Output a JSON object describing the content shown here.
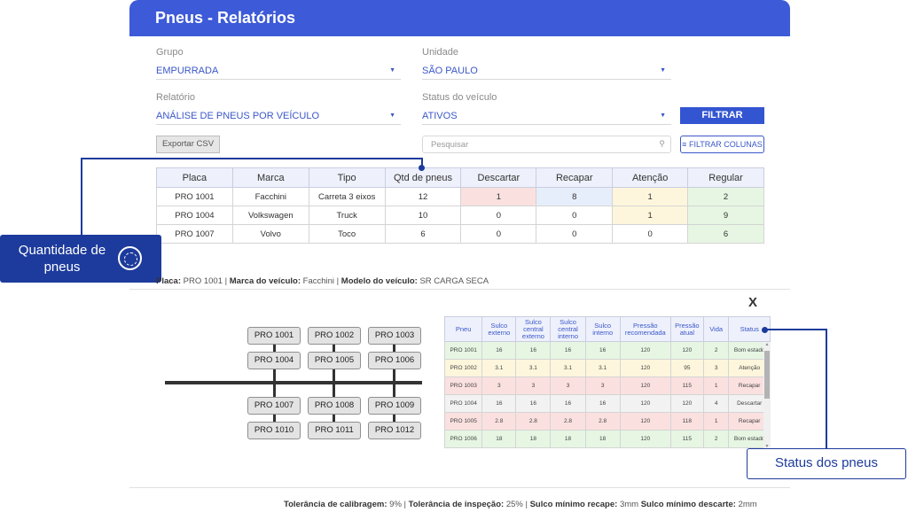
{
  "header": {
    "title": "Pneus - Relatórios"
  },
  "filters": {
    "grupo": {
      "label": "Grupo",
      "value": "EMPURRADA"
    },
    "unidade": {
      "label": "Unidade",
      "value": "SÃO PAULO"
    },
    "relatorio": {
      "label": "Relatório",
      "value": "ANÁLISE DE PNEUS POR VEÍCULO"
    },
    "status": {
      "label": "Status do veículo",
      "value": "ATIVOS"
    },
    "filtrar_label": "FILTRAR",
    "export_label": "Exportar CSV",
    "search_placeholder": "Pesquisar",
    "filter_columns_label": "FILTRAR COLUNAS"
  },
  "main_table": {
    "headers": [
      "Placa",
      "Marca",
      "Tipo",
      "Qtd de pneus",
      "Descartar",
      "Recapar",
      "Atenção",
      "Regular"
    ],
    "rows": [
      [
        "PRO 1001",
        "Facchini",
        "Carreta 3 eixos",
        "12",
        "1",
        "8",
        "1",
        "2"
      ],
      [
        "PRO 1004",
        "Volkswagen",
        "Truck",
        "10",
        "0",
        "0",
        "1",
        "9"
      ],
      [
        "PRO 1007",
        "Volvo",
        "Toco",
        "6",
        "0",
        "0",
        "0",
        "6"
      ]
    ]
  },
  "callouts": {
    "quantity": "Quantidade de pneus",
    "status": "Status dos pneus"
  },
  "vehicle_info": {
    "placa_label": "Placa:",
    "placa_value": "PRO 1001",
    "marca_label": "Marca do veículo:",
    "marca_value": "Facchini",
    "modelo_label": "Modelo do veículo:",
    "modelo_value": "SR CARGA SECA",
    "separator": "|"
  },
  "close_label": "X",
  "tire_slots": [
    "PRO 1001",
    "PRO 1002",
    "PRO 1003",
    "PRO 1004",
    "PRO 1005",
    "PRO 1006",
    "PRO 1007",
    "PRO 1008",
    "PRO 1009",
    "PRO 1010",
    "PRO 1011",
    "PRO 1012"
  ],
  "tire_table": {
    "headers": [
      "Pneu",
      "Sulco externo",
      "Sulco central externo",
      "Sulco central interno",
      "Sulco interno",
      "Pressão recomendada",
      "Pressão atual",
      "Vida",
      "Status"
    ],
    "rows": [
      {
        "cells": [
          "PRO 1001",
          "16",
          "16",
          "16",
          "16",
          "120",
          "120",
          "2",
          "Bom estado"
        ],
        "status": "green"
      },
      {
        "cells": [
          "PRO 1002",
          "3.1",
          "3.1",
          "3.1",
          "3.1",
          "120",
          "95",
          "3",
          "Atenção"
        ],
        "status": "yellow"
      },
      {
        "cells": [
          "PRO 1003",
          "3",
          "3",
          "3",
          "3",
          "120",
          "115",
          "1",
          "Recapar"
        ],
        "status": "red"
      },
      {
        "cells": [
          "PRO 1004",
          "16",
          "16",
          "16",
          "16",
          "120",
          "120",
          "4",
          "Descartar"
        ],
        "status": "gray"
      },
      {
        "cells": [
          "PRO 1005",
          "2.8",
          "2.8",
          "2.8",
          "2.8",
          "120",
          "118",
          "1",
          "Recapar"
        ],
        "status": "red"
      },
      {
        "cells": [
          "PRO 1006",
          "18",
          "18",
          "18",
          "18",
          "120",
          "115",
          "2",
          "Bom estado"
        ],
        "status": "green"
      }
    ]
  },
  "footer": {
    "calibragem_label": "Tolerância de calibragem:",
    "calibragem_value": "9%",
    "inspecao_label": "Tolerância de inspeção:",
    "inspecao_value": "25%",
    "recape_label": "Sulco mínimo recape:",
    "recape_value": "3mm",
    "descarte_label": "Sulco mínimo descarte:",
    "descarte_value": "2mm",
    "separator": "|"
  },
  "colors": {
    "header_blue": "#3d5ad8",
    "accent_blue": "#3355d1",
    "callout_navy": "#1d3b9c",
    "status_red": "#fbe0e0",
    "status_yellow": "#fdf6dc",
    "status_green": "#e6f6e3",
    "status_blue": "#e6eefb"
  },
  "icons": {
    "callout_quantity": "tire-icon",
    "select_caret": "caret-down-icon",
    "search": "search-icon",
    "filter_columns": "filter-lines-icon",
    "close": "close-icon"
  }
}
